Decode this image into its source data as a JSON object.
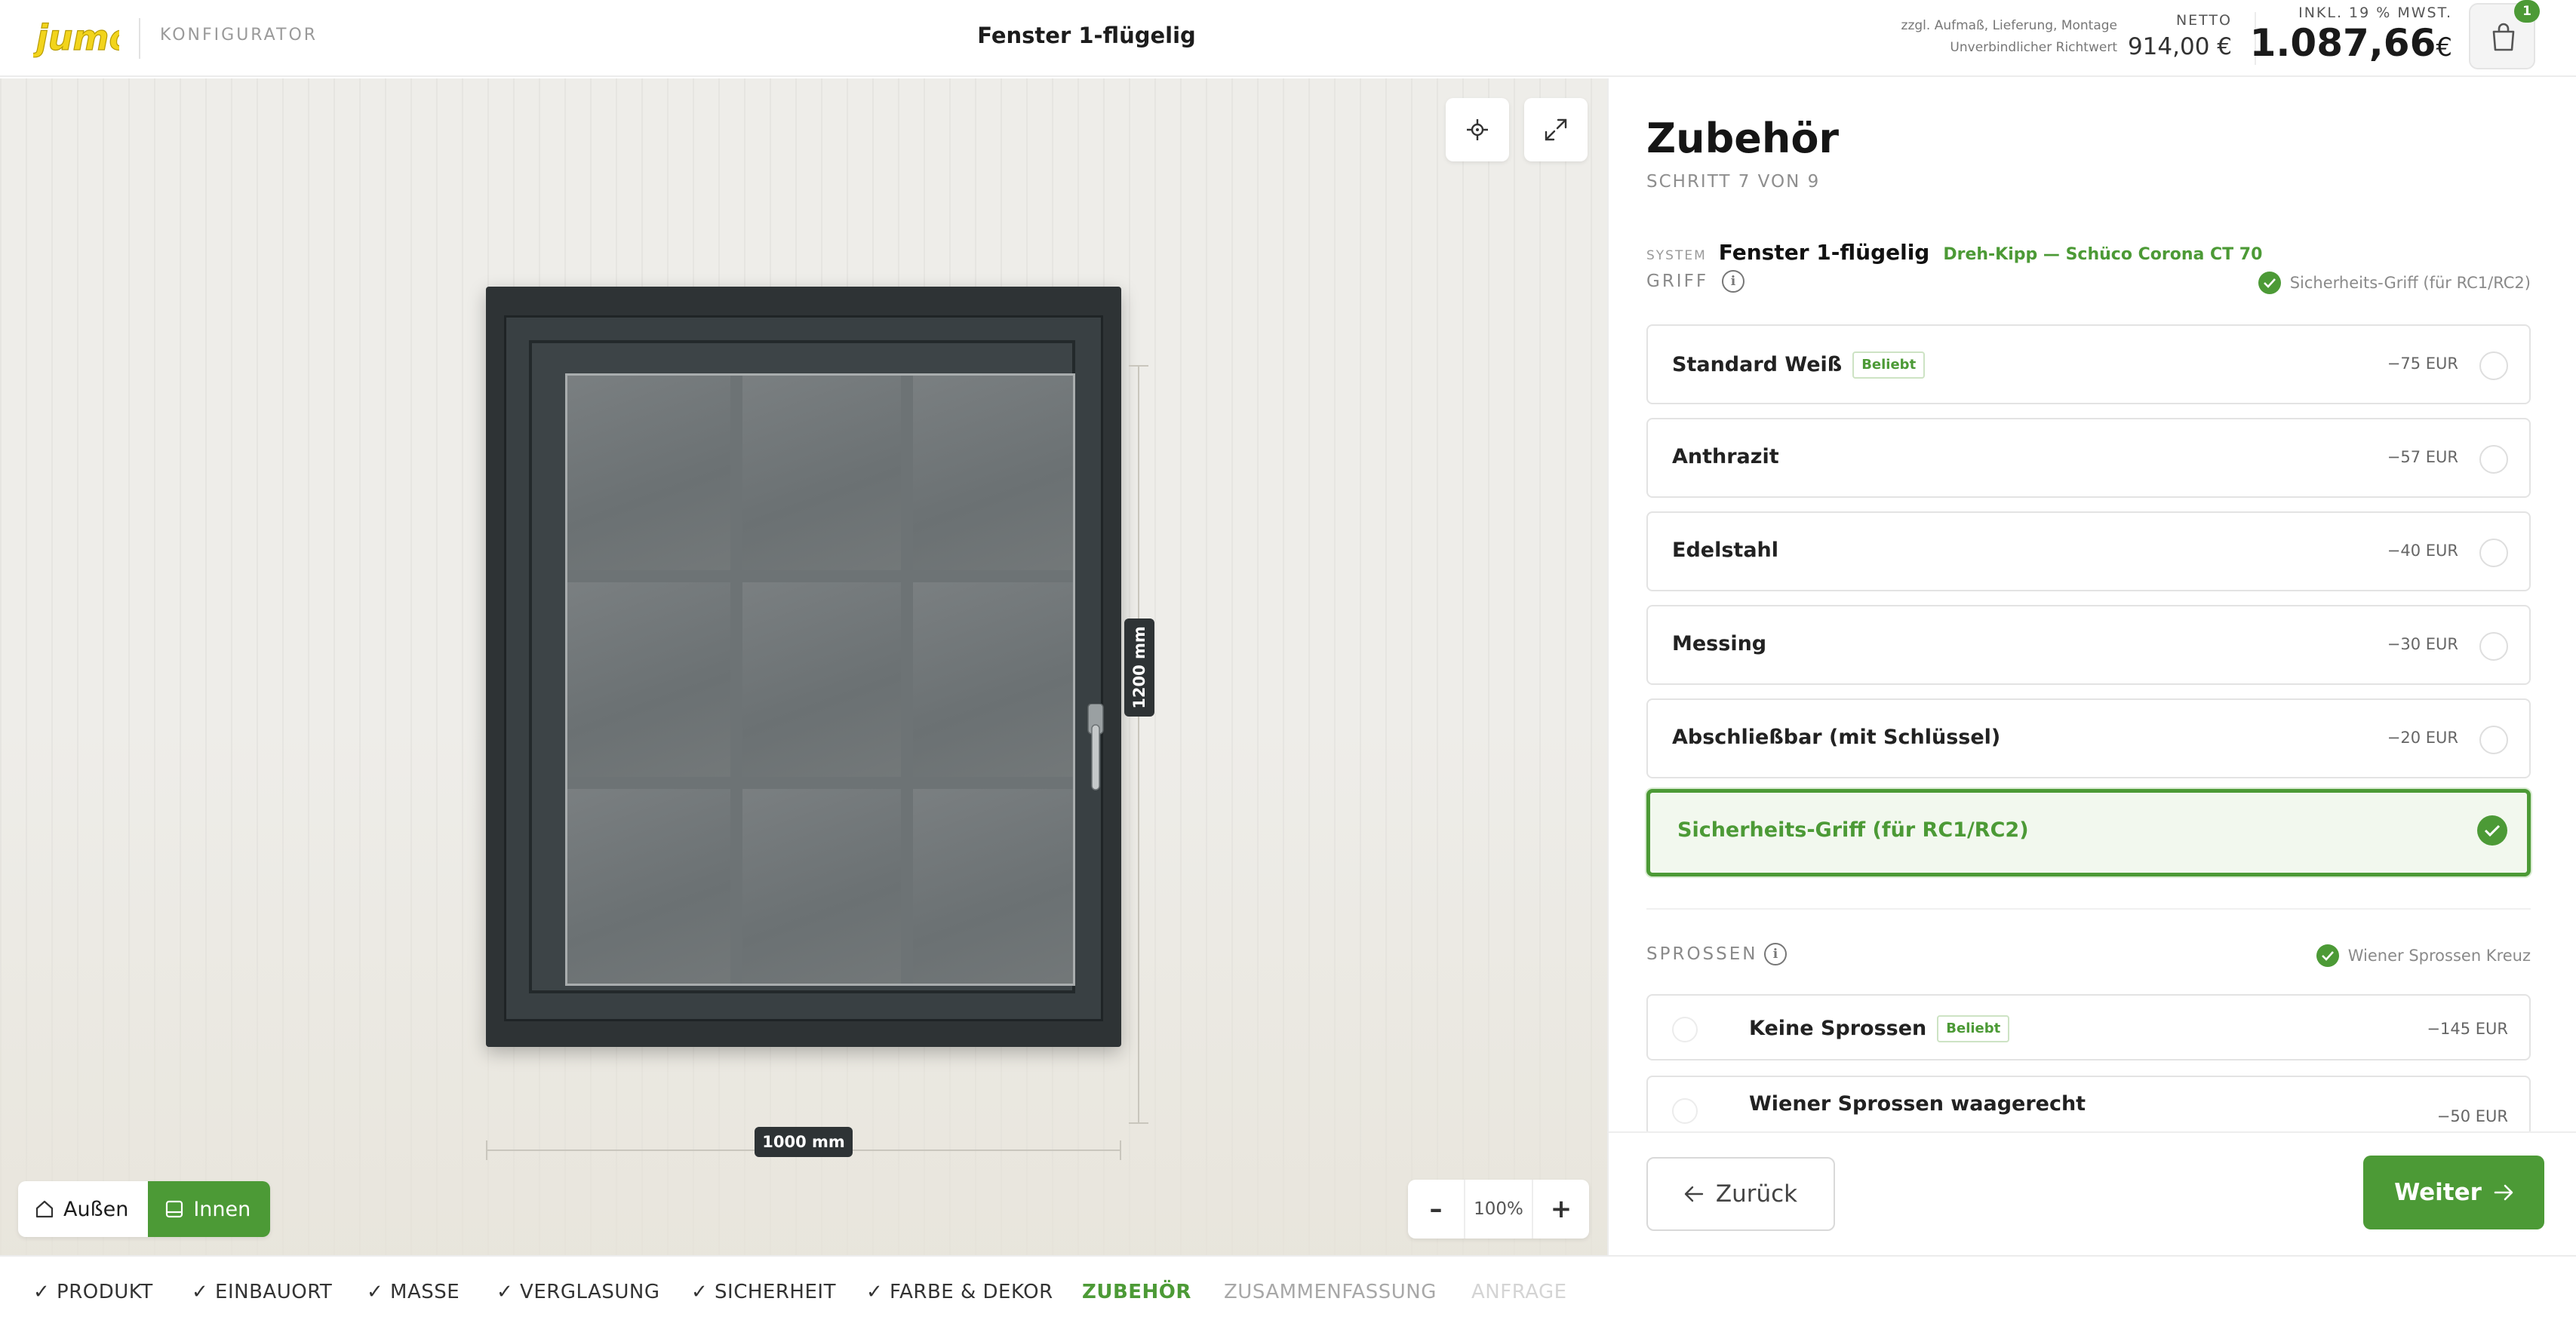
{
  "header": {
    "logo_text": "jumo",
    "app_label": "KONFIGURATOR",
    "product_title": "Fenster 1-flügelig",
    "notes_line1": "zzgl. Aufmaß, Lieferung, Montage",
    "notes_line2": "Unverbindlicher Richtwert",
    "netto_label": "NETTO",
    "netto_value": "914,00 €",
    "gross_label": "INKL. 19 % MWST.",
    "gross_value": "1.087,66",
    "currency": "€",
    "cart_count": "1",
    "cart_icon": "cart-icon"
  },
  "viewer": {
    "width_label": "1000 mm",
    "height_label": "1200 mm",
    "zoom_value": "100%",
    "zoom_minus": "–",
    "zoom_plus": "+",
    "view_outside": "Außen",
    "view_inside": "Innen",
    "active_view": "Innen",
    "frame_color": "#2e3335"
  },
  "panel": {
    "title": "Zubehör",
    "step_text": "SCHRITT 7 VON 9",
    "system_label": "SYSTEM",
    "system_name": "Fenster 1-flügelig",
    "system_sub": "Dreh-Kipp — Schüco Corona CT 70",
    "griff": {
      "label": "GRIFF",
      "selected": "Sicherheits-Griff (für RC1/RC2)",
      "options": [
        {
          "name": "Standard Weiß",
          "badge": "Beliebt",
          "price": "−75 EUR"
        },
        {
          "name": "Anthrazit",
          "badge": "",
          "price": "−57 EUR"
        },
        {
          "name": "Edelstahl",
          "badge": "",
          "price": "−40 EUR"
        },
        {
          "name": "Messing",
          "badge": "",
          "price": "−30 EUR"
        },
        {
          "name": "Abschließbar (mit Schlüssel)",
          "badge": "",
          "price": "−20 EUR"
        },
        {
          "name": "Sicherheits-Griff (für RC1/RC2)",
          "badge": "",
          "price": ""
        }
      ]
    },
    "sprossen": {
      "label": "SPROSSEN",
      "selected": "Wiener Sprossen Kreuz",
      "options": [
        {
          "name": "Keine Sprossen",
          "badge": "Beliebt",
          "price": "−145 EUR"
        },
        {
          "name": "Wiener Sprossen waagerecht",
          "badge": "",
          "price": "−50 EUR"
        }
      ]
    },
    "back_label": "Zurück",
    "next_label": "Weiter",
    "accent": "#4c9a36"
  },
  "stepnav": [
    {
      "label": "✓ PRODUKT",
      "state": "done"
    },
    {
      "label": "✓ EINBAUORT",
      "state": "done"
    },
    {
      "label": "✓ MASSE",
      "state": "done"
    },
    {
      "label": "✓ VERGLASUNG",
      "state": "done"
    },
    {
      "label": "✓ SICHERHEIT",
      "state": "done"
    },
    {
      "label": "✓ FARBE & DEKOR",
      "state": "done"
    },
    {
      "label": "ZUBEHÖR",
      "state": "active"
    },
    {
      "label": "ZUSAMMENFASSUNG",
      "state": "upcoming"
    },
    {
      "label": "ANFRAGE",
      "state": "disabled"
    }
  ]
}
